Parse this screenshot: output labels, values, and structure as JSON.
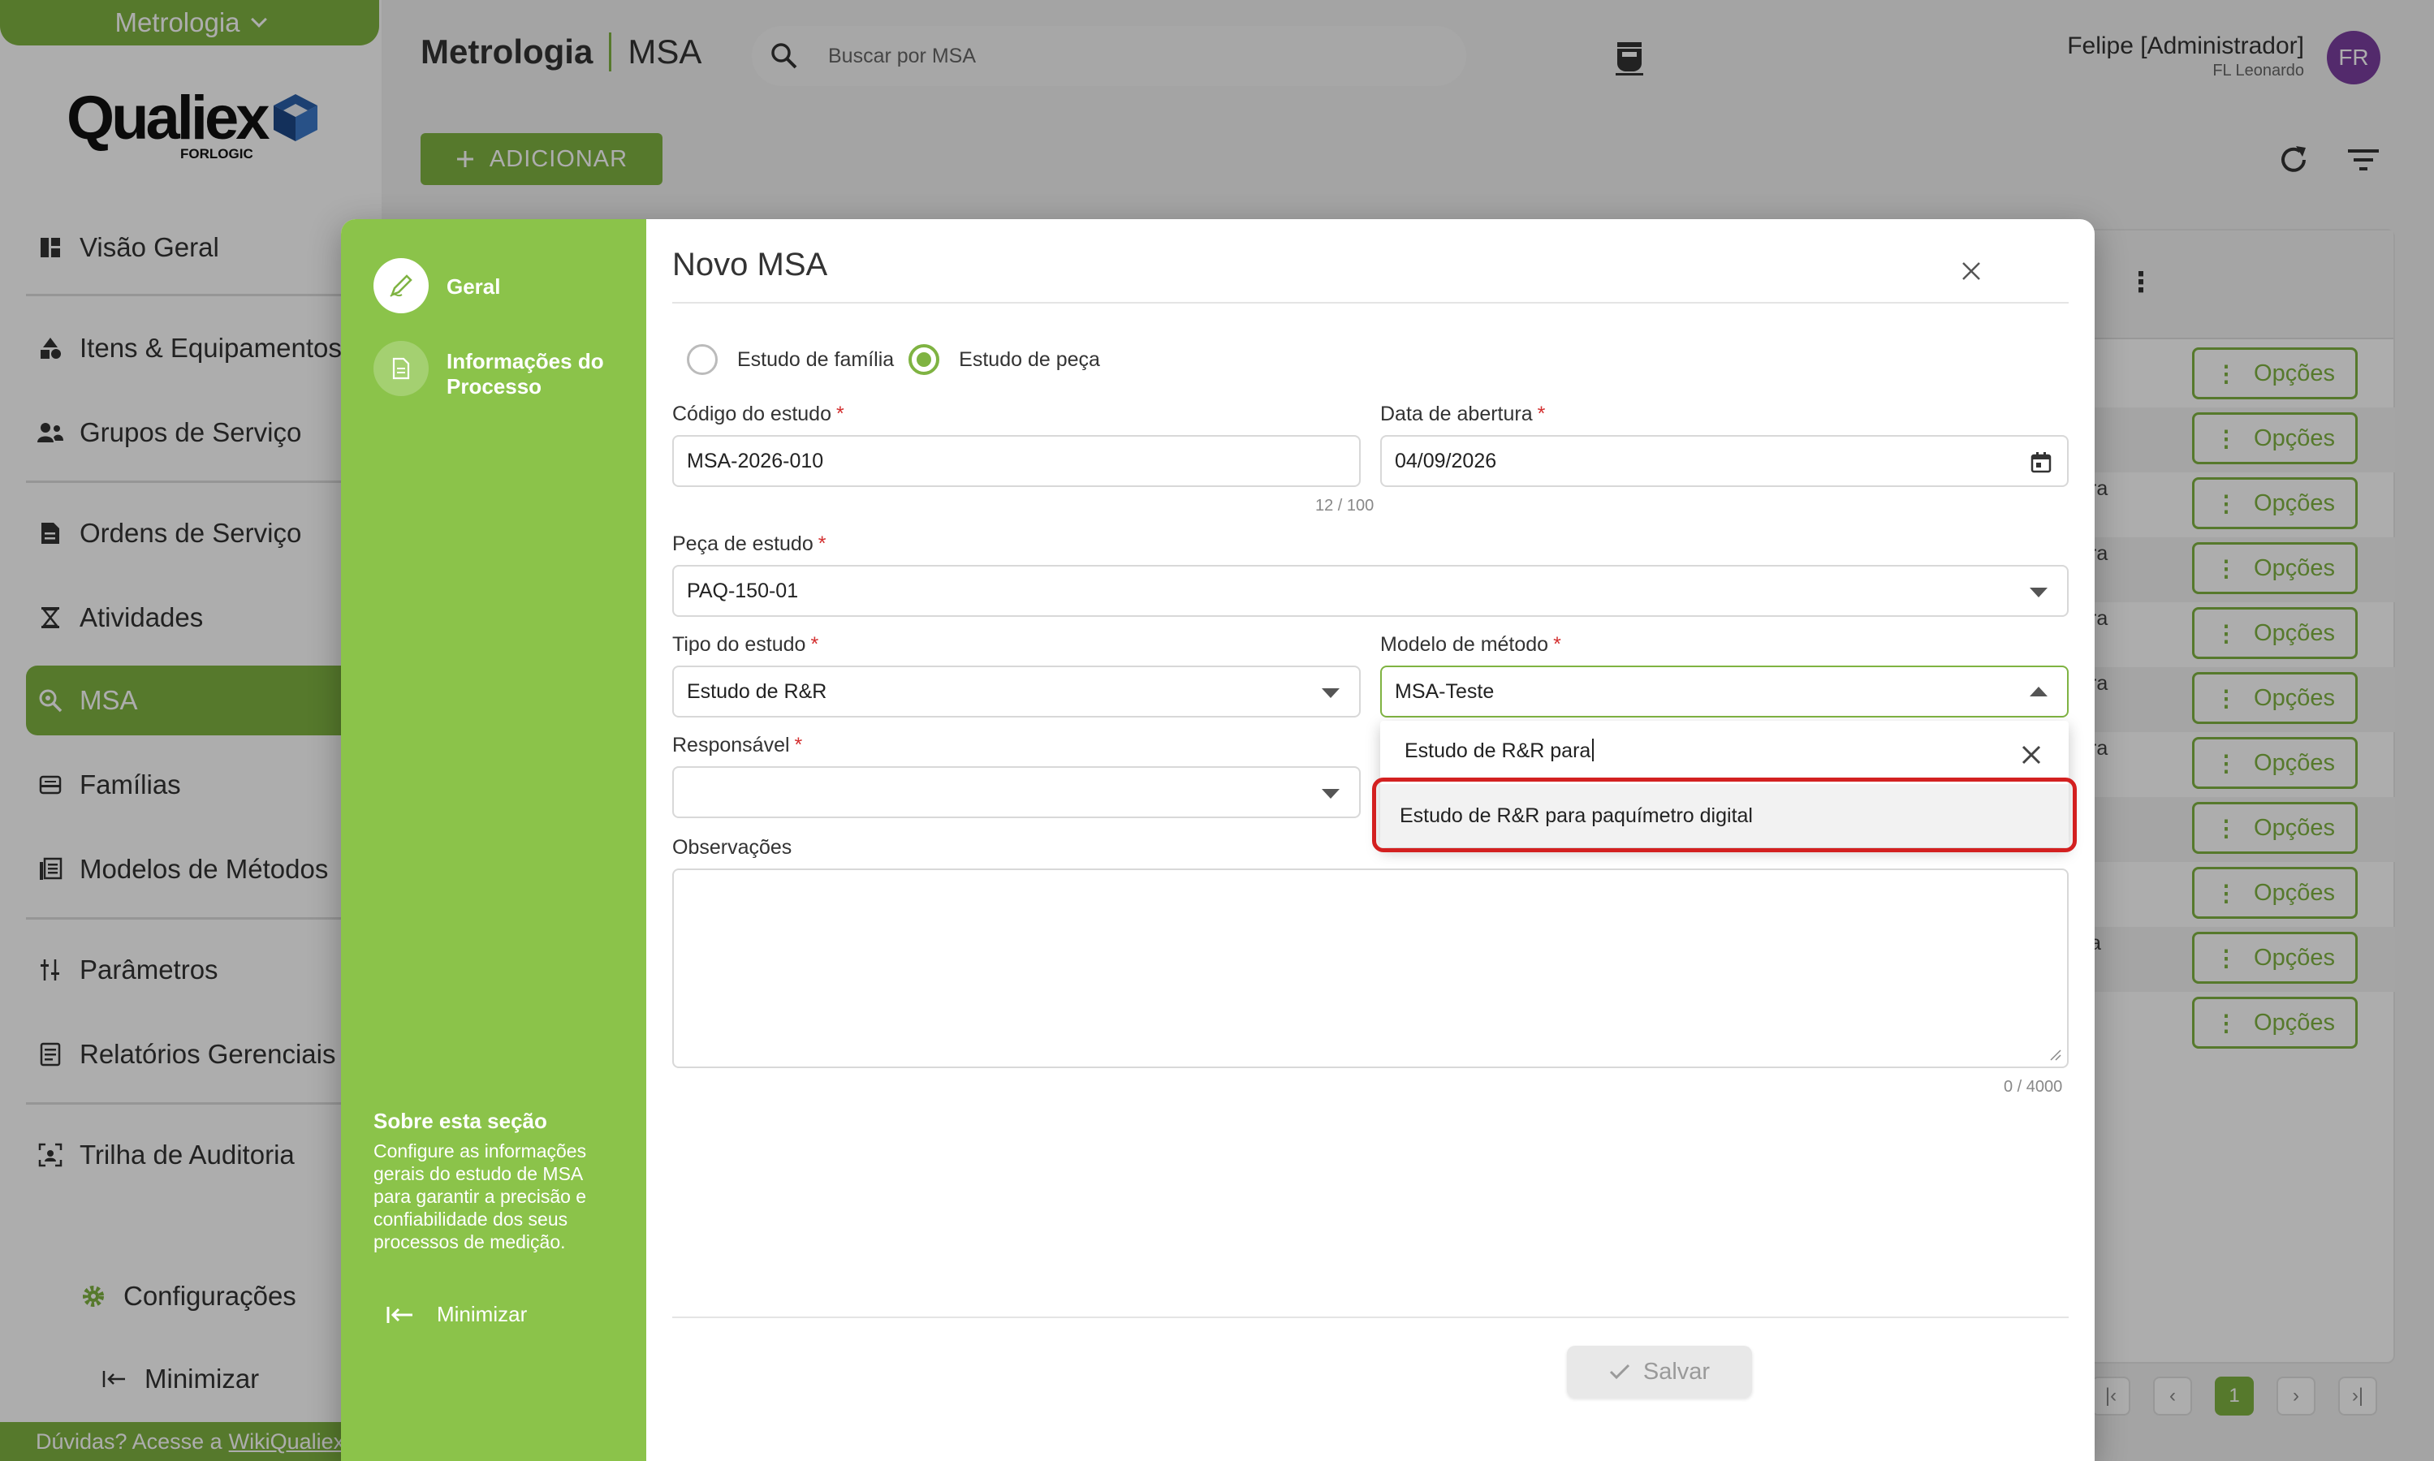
{
  "app": {
    "product": "Metrologia",
    "logo_text": "Qualiex",
    "logo_sub": "FORLOGIC"
  },
  "sidebar": {
    "items": [
      {
        "label": "Visão Geral",
        "icon": "dashboard-icon"
      },
      {
        "label": "Itens & Equipamentos",
        "icon": "shapes-icon"
      },
      {
        "label": "Grupos de Serviço",
        "icon": "group-icon"
      },
      {
        "label": "Ordens de Serviço",
        "icon": "document-icon"
      },
      {
        "label": "Atividades",
        "icon": "hourglass-icon"
      },
      {
        "label": "MSA",
        "icon": "magnify-icon",
        "active": true
      },
      {
        "label": "Famílias",
        "icon": "tray-icon"
      },
      {
        "label": "Modelos de Métodos",
        "icon": "list-icon"
      },
      {
        "label": "Parâmetros",
        "icon": "sliders-icon"
      },
      {
        "label": "Relatórios Gerenciais",
        "icon": "report-icon"
      },
      {
        "label": "Trilha de Auditoria",
        "icon": "audit-icon"
      }
    ],
    "config_label": "Configurações",
    "minimize_label": "Minimizar",
    "help_text": "Dúvidas? Acesse a",
    "help_link": "WikiQualiex"
  },
  "header": {
    "title_module": "Metrologia",
    "title_page": "MSA",
    "search_placeholder": "Buscar por MSA",
    "user_name": "Felipe [Administrador]",
    "user_org": "FL Leonardo",
    "avatar_initials": "FR"
  },
  "toolbar": {
    "add_label": "ADICIONAR"
  },
  "table": {
    "row_fragments": [
      "",
      "",
      "ra",
      "ra",
      "ra",
      "ra",
      "ra",
      "",
      "",
      "a",
      ""
    ],
    "option_label": "Opções",
    "current_page": "1"
  },
  "modal": {
    "title": "Novo MSA",
    "steps": [
      {
        "label": "Geral",
        "icon": "pencil-icon"
      },
      {
        "label": "Informações do Processo",
        "icon": "document-icon"
      }
    ],
    "about_title": "Sobre esta seção",
    "about_text": "Configure as informações gerais do estudo de MSA para garantir a precisão e confiabilidade dos seus processos de medição.",
    "minimize_label": "Minimizar",
    "radio": {
      "option1": "Estudo de família",
      "option2": "Estudo de peça",
      "selected": "Estudo de peça"
    },
    "fields": {
      "codigo_label": "Código do estudo",
      "codigo_value": "MSA-2026-010",
      "codigo_counter": "12 / 100",
      "data_label": "Data de abertura",
      "data_value": "04/09/2026",
      "peca_label": "Peça de estudo",
      "peca_value": "PAQ-150-01",
      "tipo_label": "Tipo do estudo",
      "tipo_value": "Estudo de R&R",
      "modelo_label": "Modelo de método",
      "modelo_value": "MSA-Teste",
      "responsavel_label": "Responsável",
      "responsavel_value": "",
      "obs_label": "Observações",
      "obs_counter": "0 / 4000",
      "required_mark": "*"
    },
    "dropdown": {
      "search_text": "Estudo de R&R para",
      "option": "Estudo de R&R para paquímetro digital"
    },
    "save_label": "Salvar"
  },
  "colors": {
    "brand_green": "#7fb342",
    "step_panel_green": "#8bc34a",
    "required_red": "#d32f2f",
    "highlight_red": "#d32020",
    "avatar_purple": "#7b3fa0"
  }
}
